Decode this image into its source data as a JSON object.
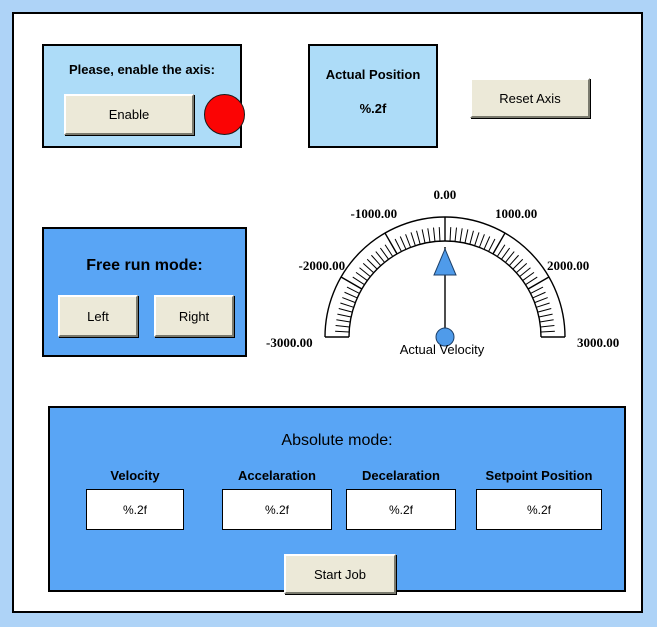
{
  "window": {
    "background_color": "#aed3f7",
    "content_background": "#ffffff"
  },
  "colors": {
    "panel_light_blue": "#addcf8",
    "panel_mid_blue": "#59a5f5",
    "button_face": "#ece9d8",
    "led_red": "#fb0404",
    "needle_blue": "#4f9bea"
  },
  "enable_panel": {
    "title": "Please, enable the axis:",
    "enable_button": "Enable",
    "led_name": "axis-status-led",
    "led_color": "#fb0404"
  },
  "position_panel": {
    "title": "Actual Position",
    "value": "%.2f"
  },
  "reset": {
    "label": "Reset Axis"
  },
  "freerun_panel": {
    "title": "Free run mode:",
    "left_button": "Left",
    "right_button": "Right"
  },
  "gauge": {
    "caption": "Actual Velocity",
    "needle_value": 0,
    "tick_labels": [
      "-3000.00",
      "-2000.00",
      "-1000.00",
      "0.00",
      "1000.00",
      "2000.00",
      "3000.00"
    ]
  },
  "absolute_panel": {
    "title": "Absolute mode:",
    "fields": [
      {
        "label": "Velocity",
        "value": "%.2f"
      },
      {
        "label": "Accelaration",
        "value": "%.2f"
      },
      {
        "label": "Decelaration",
        "value": "%.2f"
      },
      {
        "label": "Setpoint Position",
        "value": "%.2f"
      }
    ],
    "start_button": "Start Job"
  },
  "chart_data": {
    "type": "gauge",
    "title": "Actual Velocity",
    "min": -3000,
    "max": 3000,
    "value": 0,
    "unit": "",
    "major_ticks": [
      -3000,
      -2000,
      -1000,
      0,
      1000,
      2000,
      3000
    ],
    "tick_labels": [
      "-3000.00",
      "-2000.00",
      "-1000.00",
      "0.00",
      "1000.00",
      "2000.00",
      "3000.00"
    ],
    "minor_tick_count": 60,
    "start_angle_deg": 180,
    "end_angle_deg": 360,
    "needle_color": "#4f9bea",
    "grid": false,
    "legend": "none"
  }
}
